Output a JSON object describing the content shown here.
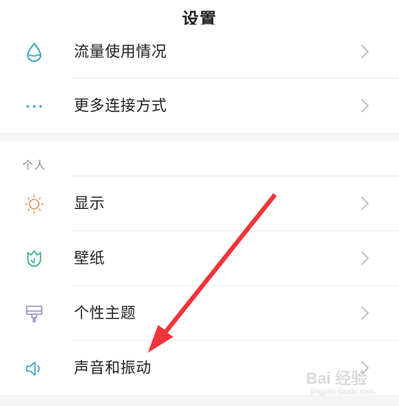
{
  "header": {
    "title": "设置"
  },
  "rows": [
    {
      "label": "流量使用情况",
      "icon": "water-drop-icon"
    },
    {
      "label": "更多连接方式",
      "icon": "more-dots-icon"
    },
    {
      "label": "显示",
      "icon": "sun-icon"
    },
    {
      "label": "壁纸",
      "icon": "tulip-icon"
    },
    {
      "label": "个性主题",
      "icon": "paint-brush-icon"
    },
    {
      "label": "声音和振动",
      "icon": "speaker-icon"
    }
  ],
  "section": {
    "personal_label": "个人"
  },
  "watermark": {
    "text": "Bai 经验",
    "sub": "jingyan.baidu.com"
  },
  "colors": {
    "icon_water": "#3aa3c8",
    "icon_dots": "#3aa3c8",
    "icon_sun": "#e0a070",
    "icon_tulip": "#3fb39a",
    "icon_brush": "#9c8cc8",
    "icon_speaker": "#3aa3c8",
    "arrow": "#f0353a",
    "chevron": "#bcbcbc"
  }
}
